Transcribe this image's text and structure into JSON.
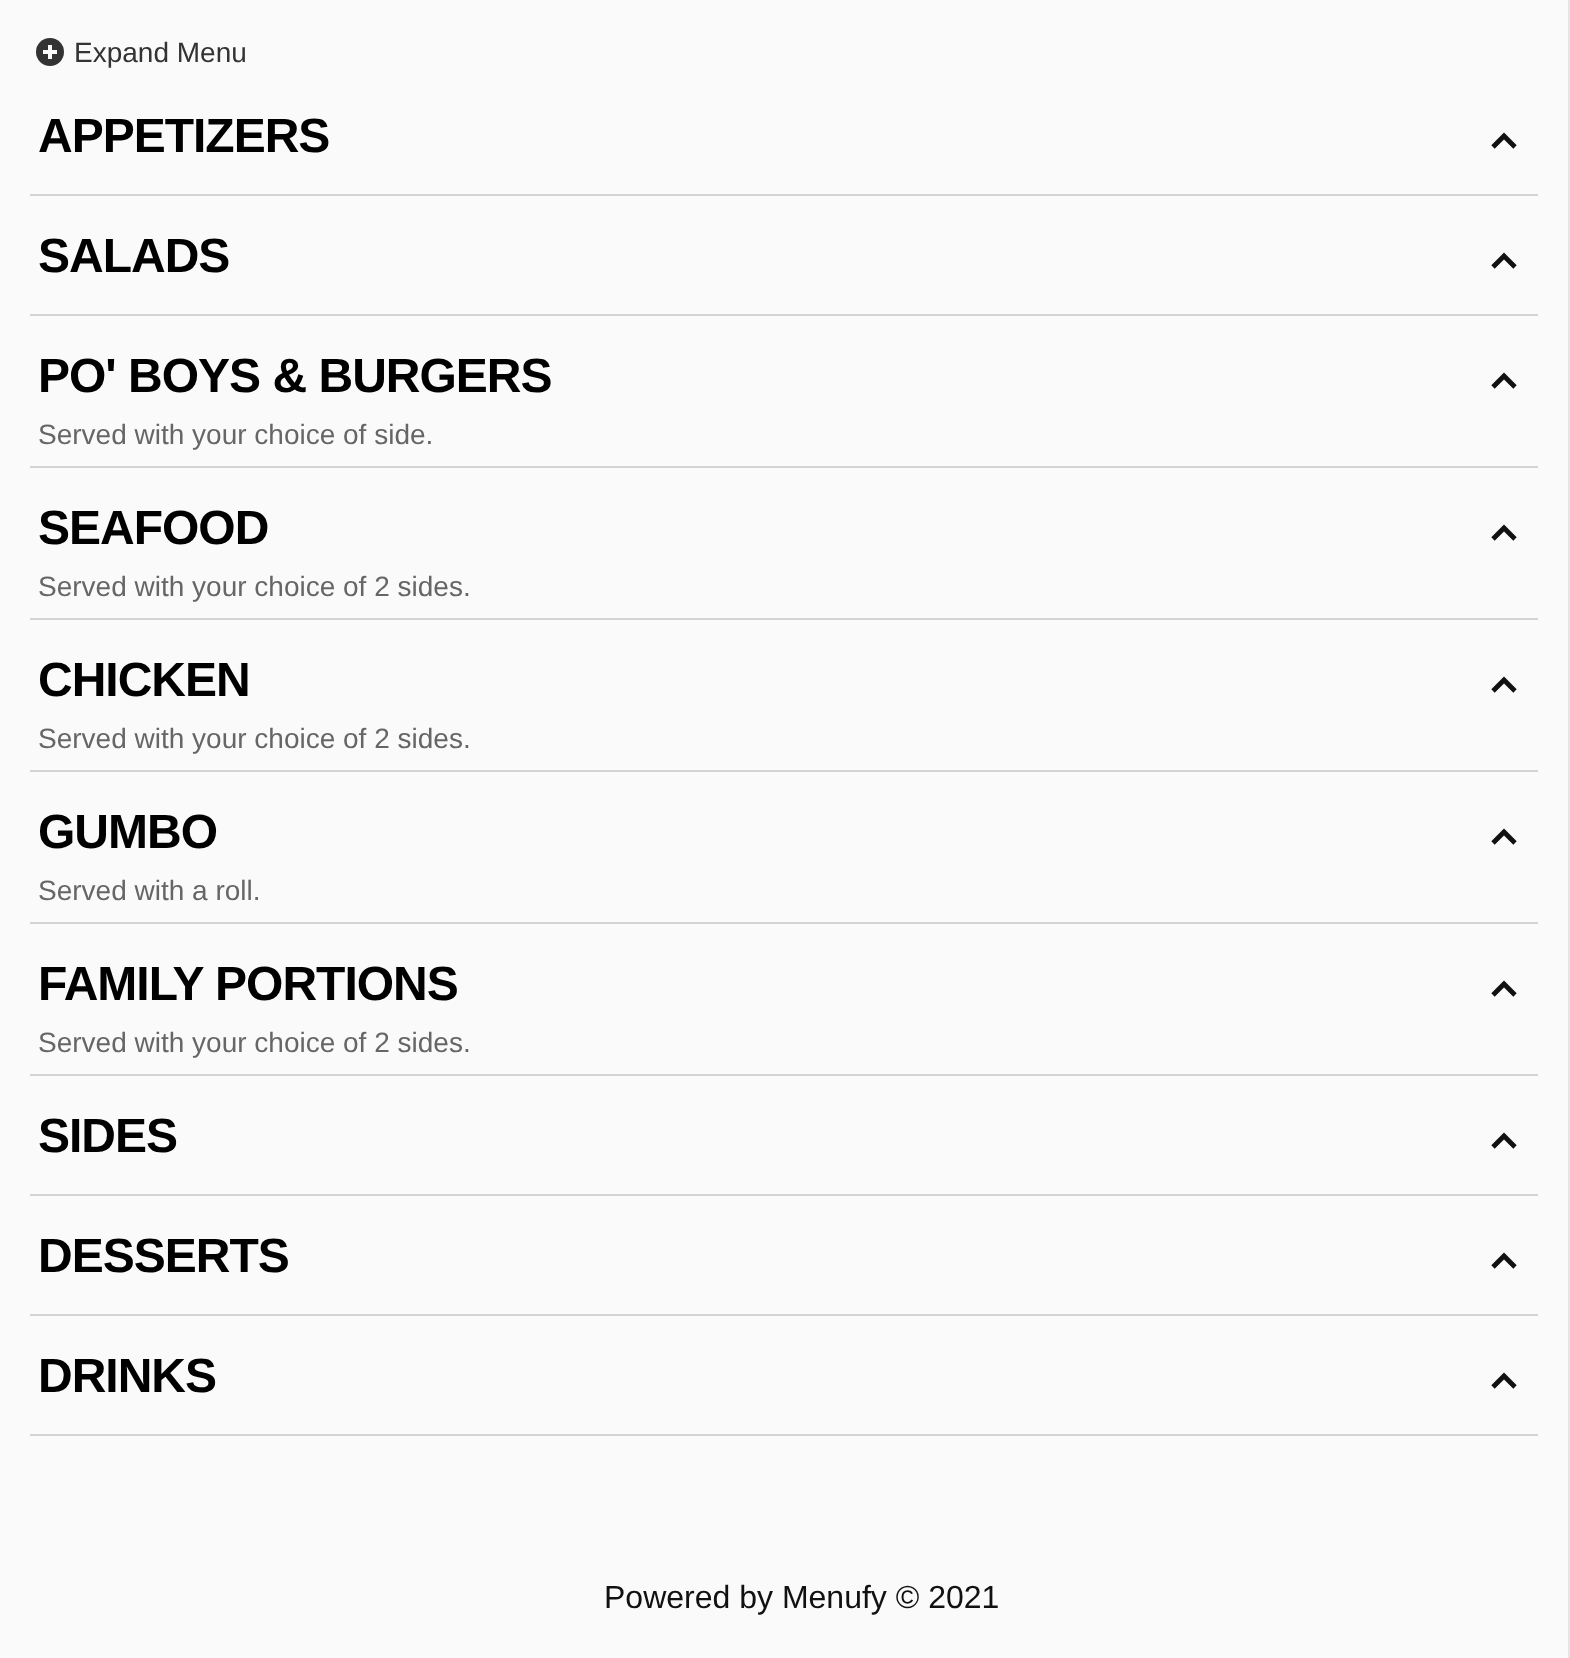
{
  "expand_menu": {
    "label": "Expand Menu"
  },
  "sections": [
    {
      "title": "APPETIZERS"
    },
    {
      "title": "SALADS"
    },
    {
      "title": "PO' BOYS & BURGERS",
      "description": "Served with your choice of side."
    },
    {
      "title": "SEAFOOD",
      "description": "Served with your choice of 2 sides."
    },
    {
      "title": "CHICKEN",
      "description": "Served with your choice of 2 sides."
    },
    {
      "title": "GUMBO",
      "description": "Served with a roll."
    },
    {
      "title": "FAMILY PORTIONS",
      "description": "Served with your choice of 2 sides."
    },
    {
      "title": "SIDES"
    },
    {
      "title": "DESSERTS"
    },
    {
      "title": "DRINKS"
    }
  ],
  "footer": "Powered by Menufy © 2021"
}
